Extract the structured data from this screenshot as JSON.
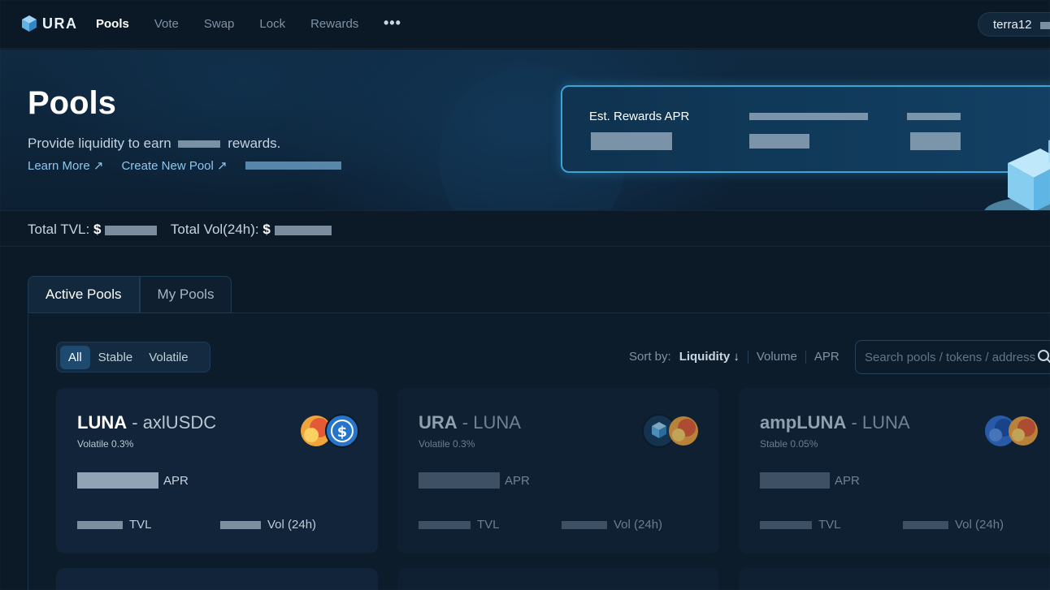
{
  "nav": {
    "logo": "URA",
    "links": [
      "Pools",
      "Vote",
      "Swap",
      "Lock",
      "Rewards"
    ],
    "active": "Pools",
    "more": "•••",
    "wallet_prefix": "terra12"
  },
  "hero": {
    "title": "Pools",
    "subtitle_before": "Provide liquidity to earn",
    "subtitle_after": "rewards.",
    "learn_more": "Learn More ↗",
    "create_pool": "Create New Pool ↗",
    "apr_card": {
      "label": "Est. Rewards APR"
    }
  },
  "stats": {
    "tvl_label": "Total TVL:",
    "vol_label": "Total Vol(24h):",
    "currency": "$"
  },
  "tabs": [
    "Active Pools",
    "My Pools"
  ],
  "filters": [
    "All",
    "Stable",
    "Volatile"
  ],
  "sort": {
    "label": "Sort by:",
    "options": [
      "Liquidity ↓",
      "Volume",
      "APR"
    ],
    "active": "Liquidity ↓"
  },
  "search": {
    "placeholder": "Search pools / tokens / address"
  },
  "pools": [
    {
      "base": "LUNA",
      "quote": "axlUSDC",
      "type": "Volatile 0.3%",
      "apr_label": "APR",
      "tvl_label": "TVL",
      "vol_label": "Vol (24h)"
    },
    {
      "base": "URA",
      "quote": "LUNA",
      "type": "Volatile 0.3%",
      "apr_label": "APR",
      "tvl_label": "TVL",
      "vol_label": "Vol (24h)"
    },
    {
      "base": "ampLUNA",
      "quote": "LUNA",
      "type": "Stable 0.05%",
      "apr_label": "APR",
      "tvl_label": "TVL",
      "vol_label": "Vol (24h)"
    }
  ],
  "colors": {
    "accent": "#3aa3d8",
    "link": "#8ec7ef",
    "bg": "#0c1a28"
  }
}
